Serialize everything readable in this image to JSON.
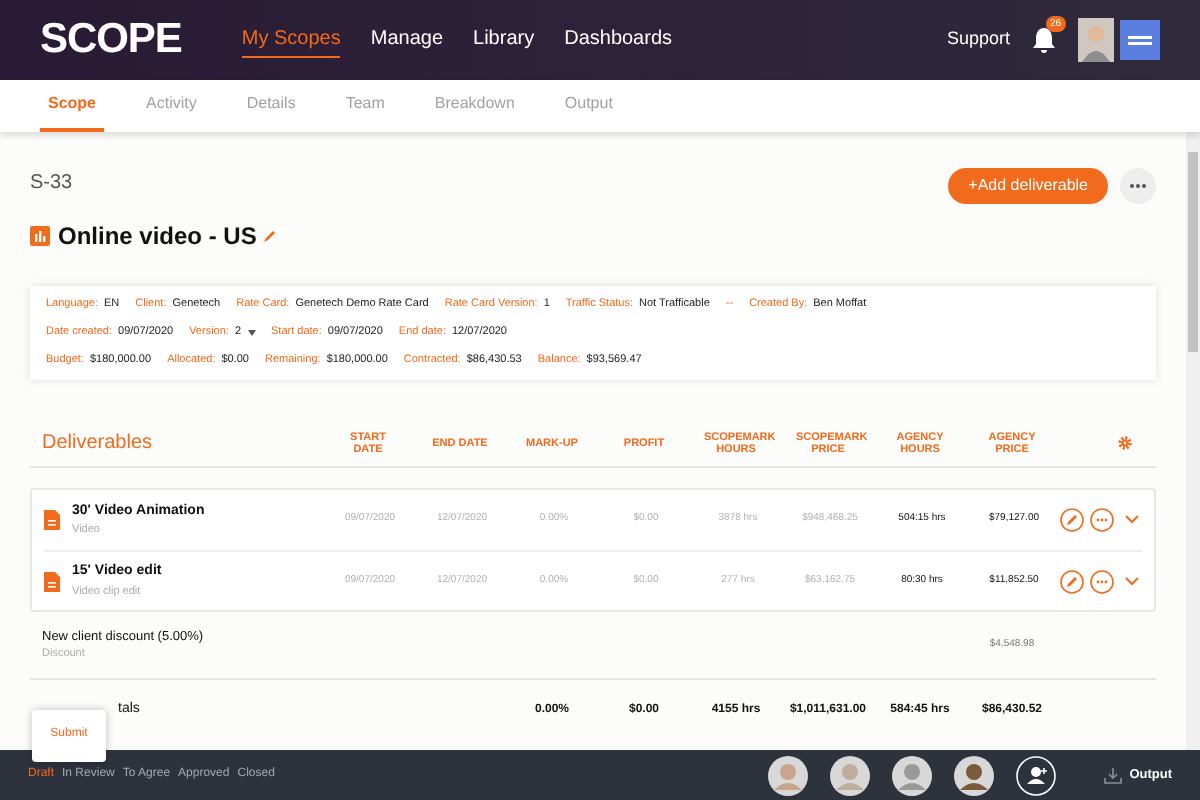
{
  "nav": {
    "logo": "SCOPE",
    "links": [
      {
        "label": "My Scopes",
        "selected": true
      },
      {
        "label": "Manage",
        "selected": false
      },
      {
        "label": "Library",
        "selected": false
      },
      {
        "label": "Dashboards",
        "selected": false
      }
    ],
    "support": "Support",
    "notification_count": "26"
  },
  "tabs": [
    {
      "label": "Scope",
      "selected": true
    },
    {
      "label": "Activity",
      "selected": false
    },
    {
      "label": "Details",
      "selected": false
    },
    {
      "label": "Team",
      "selected": false
    },
    {
      "label": "Breakdown",
      "selected": false
    },
    {
      "label": "Output",
      "selected": false
    }
  ],
  "scope": {
    "id": "S-33",
    "title": "Online video - US",
    "add_button": "+Add deliverable"
  },
  "info": [
    [
      {
        "label": "Language:",
        "value": "EN"
      },
      {
        "label": "Client:",
        "value": "Genetech"
      },
      {
        "label": "Rate Card:",
        "value": "Genetech Demo Rate Card"
      },
      {
        "label": "Rate Card Version:",
        "value": "1"
      },
      {
        "label": "Traffic Status:",
        "value": "Not Trafficable"
      },
      {
        "label": "--"
      },
      {
        "label": "Created By:",
        "value": "Ben Moffat"
      }
    ],
    [
      {
        "label": "Date created:",
        "value": "09/07/2020"
      },
      {
        "label": "Version:",
        "value": "2",
        "kind": "dropdown"
      },
      {
        "label": "Start date:",
        "value": "09/07/2020"
      },
      {
        "label": "End date:",
        "value": "12/07/2020"
      }
    ],
    [
      {
        "label": "Budget:",
        "value": "$180,000.00"
      },
      {
        "label": "Allocated:",
        "value": "$0.00"
      },
      {
        "label": "Remaining:",
        "value": "$180,000.00"
      },
      {
        "label": "Contracted:",
        "value": "$86,430.53"
      },
      {
        "label": "Balance:",
        "value": "$93,569.47"
      }
    ]
  ],
  "deliverables": {
    "title": "Deliverables",
    "columns": [
      "START DATE",
      "END DATE",
      "MARK-UP",
      "PROFIT",
      "SCOPEMARK HOURS",
      "SCOPEMARK PRICE",
      "AGENCY HOURS",
      "AGENCY PRICE"
    ],
    "rows": [
      {
        "name": "30' Video Animation",
        "type": "Video",
        "cells": [
          "09/07/2020",
          "12/07/2020",
          "0.00%",
          "$0.00",
          "3878 hrs",
          "$948,468.25",
          "504:15 hrs",
          "$79,127.00"
        ]
      },
      {
        "name": "15' Video edit",
        "type": "Video clip edit",
        "cells": [
          "09/07/2020",
          "12/07/2020",
          "0.00%",
          "$0.00",
          "277 hrs",
          "$63,162.75",
          "80:30 hrs",
          "$11,852.50"
        ]
      }
    ]
  },
  "discount": {
    "name": "New client discount (5.00%)",
    "type": "Discount",
    "amount": "$4,548.98"
  },
  "totals": {
    "label": "tals",
    "cells": [
      "0.00%",
      "$0.00",
      "4155 hrs",
      "$1,011,631.00",
      "584:45 hrs",
      "$86,430.52"
    ]
  },
  "submit_popover": "Submit",
  "statuses": [
    {
      "label": "Draft",
      "selected": true
    },
    {
      "label": "In Review",
      "selected": false
    },
    {
      "label": "To Agree",
      "selected": false
    },
    {
      "label": "Approved",
      "selected": false
    },
    {
      "label": "Closed",
      "selected": false
    }
  ],
  "output_button": "Output"
}
